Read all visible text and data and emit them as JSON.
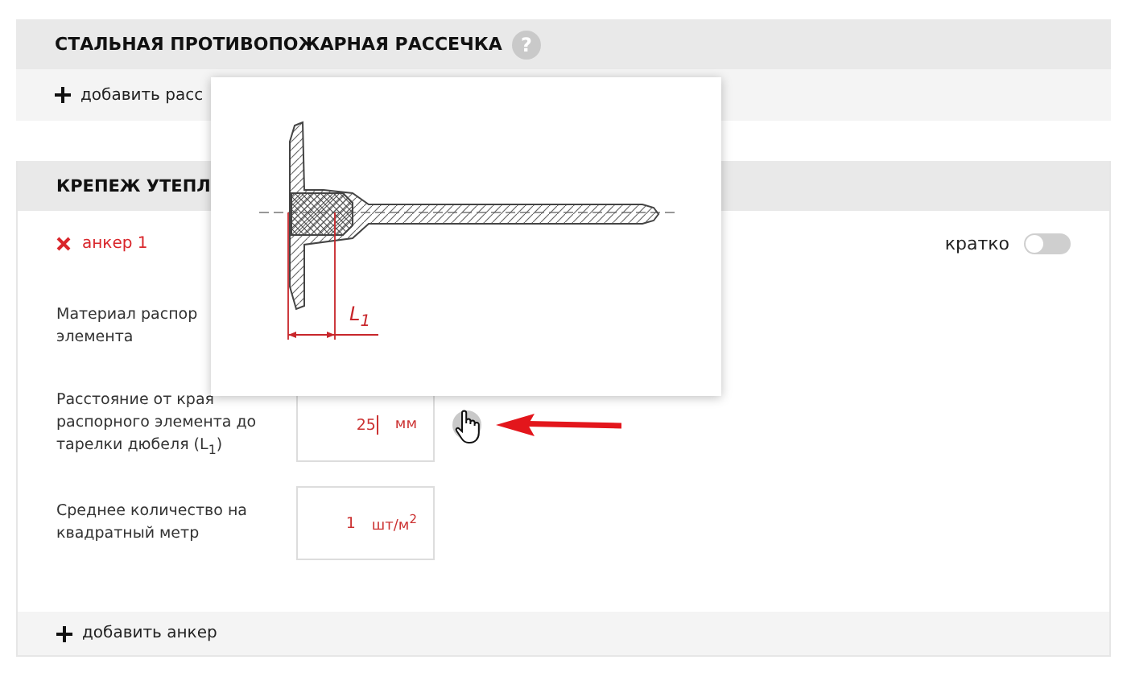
{
  "sections": [
    {
      "kind": "simple",
      "title": "СТАЛЬНАЯ ПРОТИВОПОЖАРНАЯ РАССЕЧКА",
      "help": "?",
      "add_label": "добавить расс"
    },
    {
      "kind": "anchors",
      "title": "КРЕПЕЖ УТЕПЛ",
      "item": {
        "name": "анкер 1"
      },
      "toggle": {
        "label": "кратко",
        "on": false
      },
      "fields": [
        {
          "kind": "covered",
          "label_lines": [
            "Материал распор",
            "элемента"
          ]
        },
        {
          "kind": "input",
          "label": "Расстояние от края распорного элемента до тарелки дюбеля (L$_{1}$)",
          "value": "25",
          "unit": "мм",
          "help": true,
          "focused": true
        },
        {
          "kind": "input",
          "label": "Среднее количество на квадратный метр",
          "value": "1",
          "unit": "шт/м$^{2}$",
          "help": false,
          "focused": false
        }
      ],
      "add_label": "добавить анкер"
    }
  ],
  "popup": {
    "label": "L$_{1}$"
  }
}
